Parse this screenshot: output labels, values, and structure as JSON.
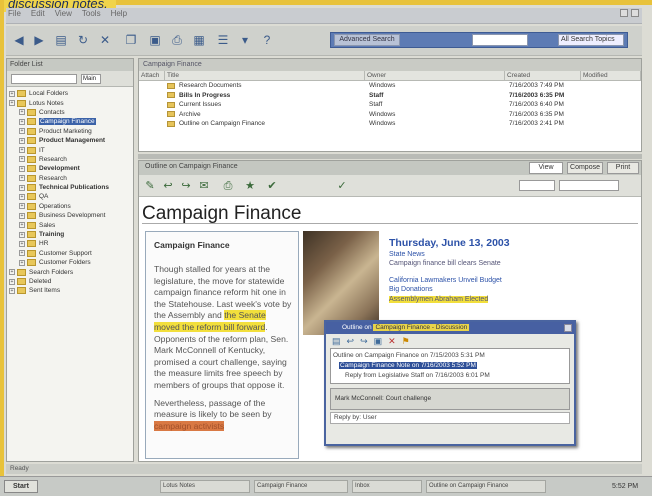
{
  "caption": "discussion notes.",
  "menu": [
    "File",
    "Edit",
    "View",
    "Tools",
    "Help"
  ],
  "search": {
    "button_label": "Advanced Search",
    "scope_value": "All Search Topics"
  },
  "left_pane": {
    "header": "Folder List",
    "scope_value": "Main",
    "items": [
      {
        "label": "Local Folders",
        "level": 0,
        "selected": false,
        "bold": false
      },
      {
        "label": "Lotus Notes",
        "level": 0,
        "selected": false,
        "bold": false
      },
      {
        "label": "Contacts",
        "level": 1,
        "selected": false,
        "bold": false
      },
      {
        "label": "Campaign Finance",
        "level": 1,
        "selected": true,
        "bold": false
      },
      {
        "label": "Product Marketing",
        "level": 1,
        "selected": false,
        "bold": false
      },
      {
        "label": "Product Management",
        "level": 1,
        "selected": false,
        "bold": true
      },
      {
        "label": "IT",
        "level": 1,
        "selected": false,
        "bold": false
      },
      {
        "label": "Research",
        "level": 1,
        "selected": false,
        "bold": false
      },
      {
        "label": "Development",
        "level": 1,
        "selected": false,
        "bold": true
      },
      {
        "label": "Research",
        "level": 1,
        "selected": false,
        "bold": false
      },
      {
        "label": "Technical Publications",
        "level": 1,
        "selected": false,
        "bold": true
      },
      {
        "label": "QA",
        "level": 1,
        "selected": false,
        "bold": false
      },
      {
        "label": "Operations",
        "level": 1,
        "selected": false,
        "bold": false
      },
      {
        "label": "Business Development",
        "level": 1,
        "selected": false,
        "bold": false
      },
      {
        "label": "Sales",
        "level": 1,
        "selected": false,
        "bold": false
      },
      {
        "label": "Training",
        "level": 1,
        "selected": false,
        "bold": true
      },
      {
        "label": "HR",
        "level": 1,
        "selected": false,
        "bold": false
      },
      {
        "label": "Customer Support",
        "level": 1,
        "selected": false,
        "bold": false
      },
      {
        "label": "Customer Folders",
        "level": 1,
        "selected": false,
        "bold": false
      },
      {
        "label": "Search Folders",
        "level": 0,
        "selected": false,
        "bold": false
      },
      {
        "label": "Deleted",
        "level": 0,
        "selected": false,
        "bold": false
      },
      {
        "label": "Sent Items",
        "level": 0,
        "selected": false,
        "bold": false
      }
    ]
  },
  "list_pane": {
    "header": "Campaign Finance",
    "columns": [
      "Attach",
      "Title",
      "Owner",
      "Created",
      "Modified"
    ],
    "rows": [
      {
        "title": "Research Documents",
        "owner": "Windows",
        "created": "7/16/2003 7:49 PM",
        "bold": false
      },
      {
        "title": "Bills In Progress",
        "owner": "Staff",
        "created": "7/16/2003 6:35 PM",
        "bold": true
      },
      {
        "title": "Current Issues",
        "owner": "Staff",
        "created": "7/16/2003 6:40 PM",
        "bold": false
      },
      {
        "title": "Archive",
        "owner": "Windows",
        "created": "7/16/2003 6:35 PM",
        "bold": false
      },
      {
        "title": "Outline on Campaign Finance",
        "owner": "Windows",
        "created": "7/16/2003 2:41 PM",
        "bold": false
      }
    ]
  },
  "doc_pane": {
    "tab_label": "Outline on Campaign Finance",
    "tabs": [
      "View",
      "Compose",
      "Print"
    ],
    "title": "Campaign Finance",
    "article_heading": "Campaign Finance",
    "article_text_1": "Though stalled for years at the legislature, the move for statewide campaign finance reform hit one in the Statehouse. Last week's vote by the Assembly and",
    "article_highlight": "the Senate moved the reform bill forward",
    "article_text_2": ". Opponents of the reform plan, Sen. Mark McConnell of Kentucky, promised a court challenge, saying the measure limits free speech by members of groups that oppose it.",
    "article_text_3": "Nevertheless, passage of the measure is likely to be seen by",
    "article_highlight_2": "campaign activists",
    "news_date": "Thursday, June 13, 2003",
    "news_link_1": "State News",
    "news_link_2": "Campaign finance bill clears Senate",
    "news_link_3": "California Lawmakers Unveil Budget",
    "news_link_4": "Big Donations",
    "news_link_5": "Assemblymen Abraham Elected"
  },
  "popup": {
    "title_pre": "Outline on",
    "title_selected": "Campaign Finance - Discussion",
    "rows": [
      {
        "label": "Outline on Campaign Finance on 7/15/2003 5:31 PM",
        "selected": false
      },
      {
        "label": "Campaign Finance Note on 7/16/2003 5:52 PM",
        "selected": true
      },
      {
        "label": "Reply from Legislative Staff on 7/16/2003 6:01 PM",
        "selected": false
      }
    ],
    "sub_label": "Mark McConnell: Court challenge",
    "foot_label": "Reply by: User"
  },
  "status_text": "Ready",
  "taskbar": {
    "start_label": "Start",
    "items": [
      "Lotus Notes",
      "Campaign Finance",
      "Inbox",
      "Outline on Campaign Finance"
    ],
    "clock": "5:52 PM"
  }
}
